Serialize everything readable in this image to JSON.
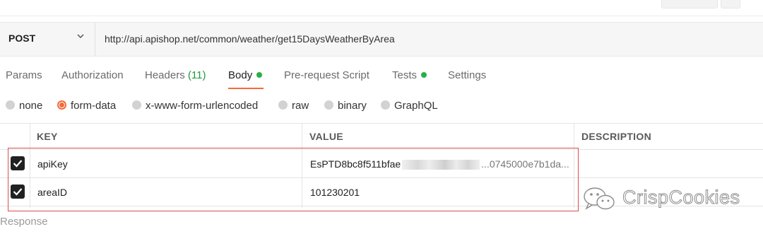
{
  "request": {
    "method": "POST",
    "url": "http://api.apishop.net/common/weather/get15DaysWeatherByArea"
  },
  "tabs": [
    {
      "label": "Params"
    },
    {
      "label": "Authorization"
    },
    {
      "label": "Headers",
      "count": "(11)"
    },
    {
      "label": "Body",
      "indicator": "green-dot",
      "active": true
    },
    {
      "label": "Pre-request Script"
    },
    {
      "label": "Tests",
      "indicator": "green-dot"
    },
    {
      "label": "Settings"
    }
  ],
  "body_types": [
    {
      "label": "none",
      "selected": false
    },
    {
      "label": "form-data",
      "selected": true
    },
    {
      "label": "x-www-form-urlencoded",
      "selected": false
    },
    {
      "label": "raw",
      "selected": false
    },
    {
      "label": "binary",
      "selected": false
    },
    {
      "label": "GraphQL",
      "selected": false
    }
  ],
  "table": {
    "headers": {
      "key": "KEY",
      "value": "VALUE",
      "description": "DESCRIPTION"
    },
    "rows": [
      {
        "checked": true,
        "key": "apiKey",
        "value_visible": "EsPTD8bc8f511bfae",
        "value_tail": "...0745000e7b1da...",
        "description": ""
      },
      {
        "checked": true,
        "key": "areaID",
        "value_visible": "101230201",
        "value_tail": "",
        "description": ""
      }
    ]
  },
  "response_label": "Response",
  "watermark": "CrispCookies",
  "colors": {
    "accent": "#f26b3a",
    "success": "#26b047",
    "highlight": "#d9504d"
  }
}
